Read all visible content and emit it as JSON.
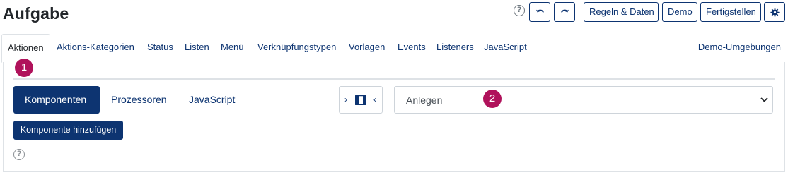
{
  "page": {
    "title": "Aufgabe"
  },
  "toolbar": {
    "help_icon": "question-circle-icon",
    "undo_icon": "undo-icon",
    "redo_icon": "redo-icon",
    "rules_label": "Regeln & Daten",
    "demo_label": "Demo",
    "finish_label": "Fertigstellen",
    "settings_icon": "gear-icon"
  },
  "tabs": [
    {
      "label": "Aktionen",
      "active": true
    },
    {
      "label": "Aktions-Kategorien"
    },
    {
      "label": "Status"
    },
    {
      "label": "Listen"
    },
    {
      "label": "Menü"
    },
    {
      "label": "Verknüpfungstypen"
    },
    {
      "label": "Vorlagen"
    },
    {
      "label": "Events"
    },
    {
      "label": "Listeners"
    },
    {
      "label": "JavaScript"
    }
  ],
  "tab_right": {
    "label": "Demo-Umgebungen"
  },
  "markers": {
    "one": "1",
    "two": "2"
  },
  "segments": [
    {
      "label": "Komponenten",
      "active": true
    },
    {
      "label": "Prozessoren"
    },
    {
      "label": "JavaScript"
    }
  ],
  "panel_toggle": {
    "left_chevron": "›",
    "right_chevron": "‹",
    "icon": "columns-icon"
  },
  "select": {
    "value": "Anlegen"
  },
  "add_component": {
    "label": "Komponente hinzufügen"
  },
  "help_bottom": {
    "icon": "question-circle-icon",
    "glyph": "?"
  },
  "colors": {
    "brand": "#0d3471",
    "marker": "#b0125b",
    "border": "#dee2e6"
  }
}
